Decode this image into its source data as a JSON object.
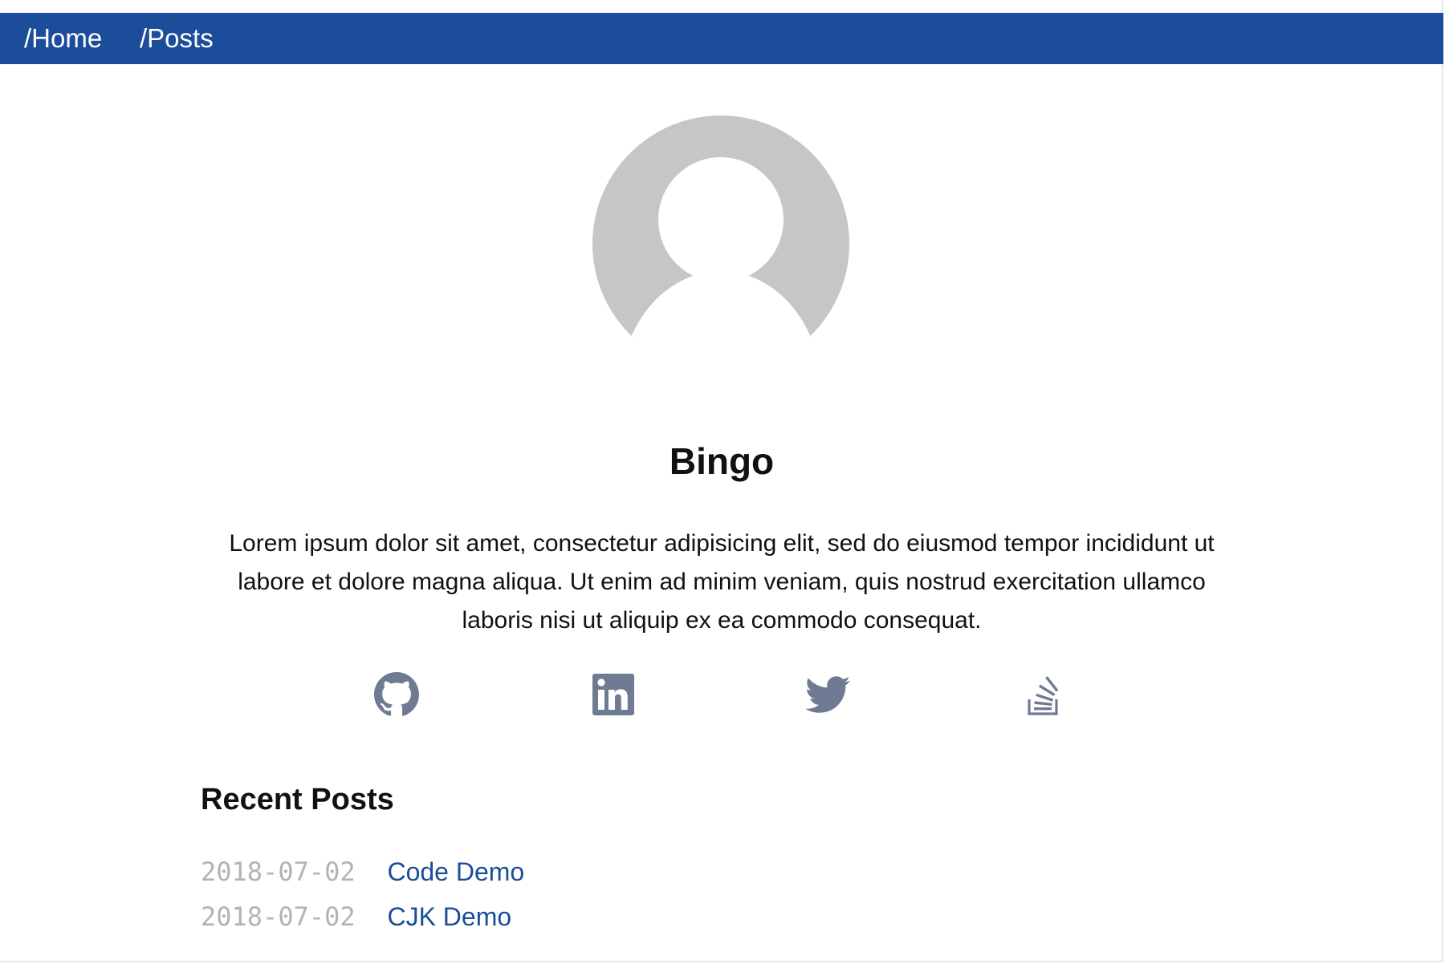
{
  "nav": {
    "items": [
      {
        "label": "/Home"
      },
      {
        "label": "/Posts"
      }
    ]
  },
  "profile": {
    "avatar_icon": "default-user-avatar",
    "name": "Bingo",
    "bio": "Lorem ipsum dolor sit amet, consectetur adipisicing elit, sed do eiusmod tempor incididunt ut labore et dolore magna aliqua. Ut enim ad minim veniam, quis nostrud exercitation ullamco laboris nisi ut aliquip ex ea commodo consequat."
  },
  "social": [
    {
      "icon": "github-icon"
    },
    {
      "icon": "linkedin-icon"
    },
    {
      "icon": "twitter-icon"
    },
    {
      "icon": "stackoverflow-icon"
    }
  ],
  "recent_posts": {
    "title": "Recent Posts",
    "items": [
      {
        "date": "2018-07-02",
        "title": "Code Demo"
      },
      {
        "date": "2018-07-02",
        "title": "CJK Demo"
      }
    ]
  },
  "colors": {
    "navbar": "#1c4d9a",
    "link": "#1c4d9a",
    "date": "#b3b3b3",
    "icon": "#6f7a93",
    "avatar": "#c6c6c6"
  }
}
